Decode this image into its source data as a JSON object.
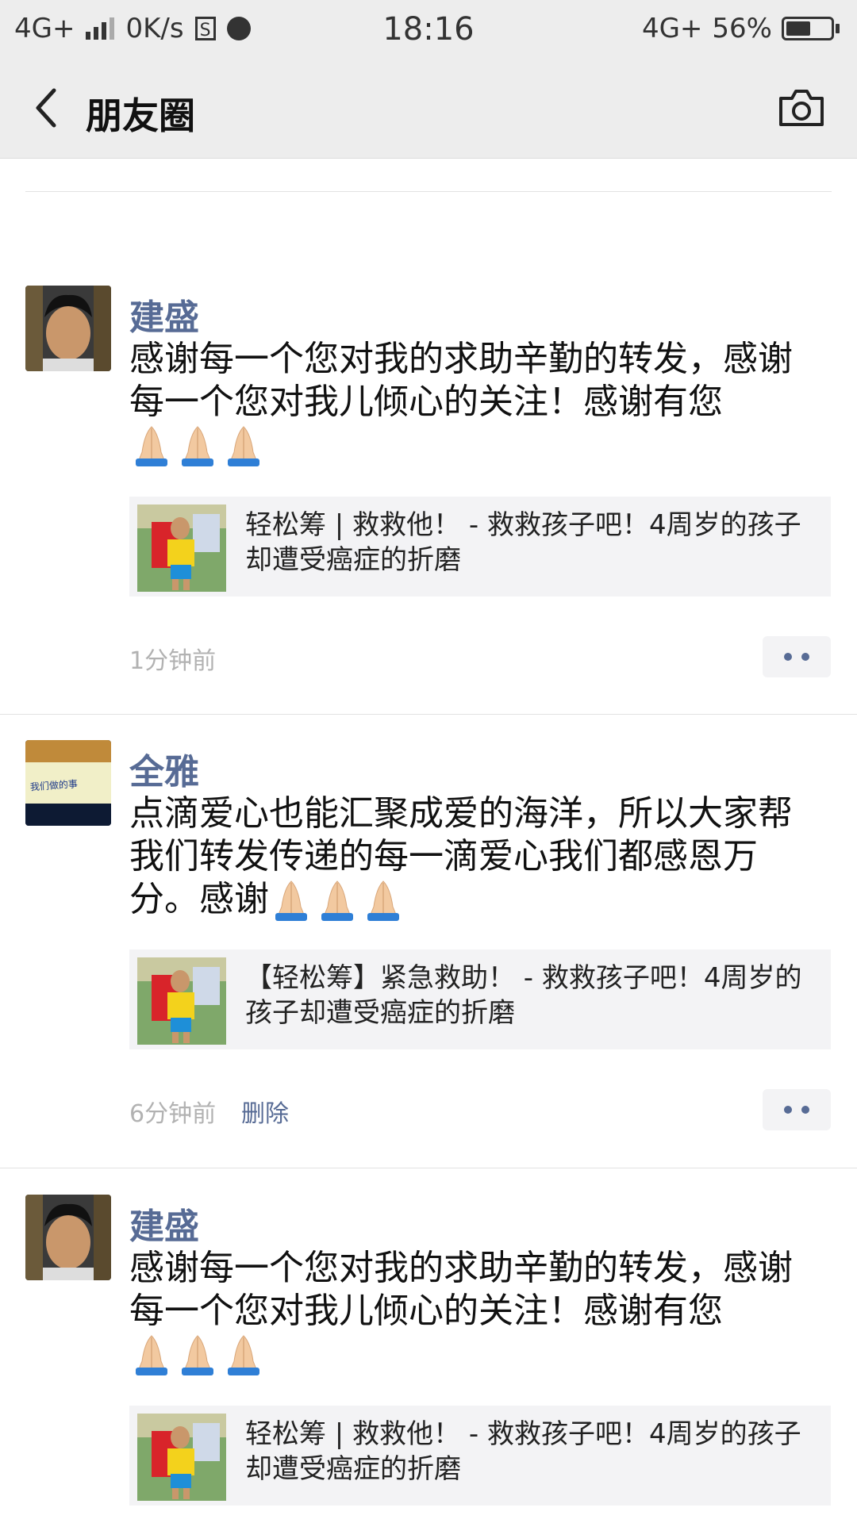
{
  "status_bar": {
    "network_left": "4G+",
    "speed": "0K/s",
    "time": "18:16",
    "network_right": "4G+",
    "battery": "56%",
    "battery_level": 0.56
  },
  "nav": {
    "title": "朋友圈"
  },
  "posts": [
    {
      "author": "建盛",
      "text": "感谢每一个您对我的求助辛勤的转发，感谢每一个您对我儿倾心的关注！感谢有您",
      "link_title": "轻松筹 | 救救他！ - 救救孩子吧！4周岁的孩子却遭受癌症的折磨",
      "time": "1分钟前"
    },
    {
      "author": "全雅",
      "text": "点滴爱心也能汇聚成爱的海洋，所以大家帮我们转发传递的每一滴爱心我们都感恩万分。感谢",
      "link_title": "【轻松筹】紧急救助！ - 救救孩子吧！4周岁的孩子却遭受癌症的折磨",
      "time": "6分钟前",
      "delete_label": "删除"
    },
    {
      "author": "建盛",
      "text": "感谢每一个您对我的求助辛勤的转发，感谢每一个您对我儿倾心的关注！感谢有您",
      "link_title": "轻松筹 | 救救他！ - 救救孩子吧！4周岁的孩子却遭受癌症的折磨"
    }
  ],
  "colors": {
    "author": "#576b95",
    "nav_bg": "#ededed",
    "card_bg": "#f3f3f5",
    "meta": "#b2b2b2"
  }
}
